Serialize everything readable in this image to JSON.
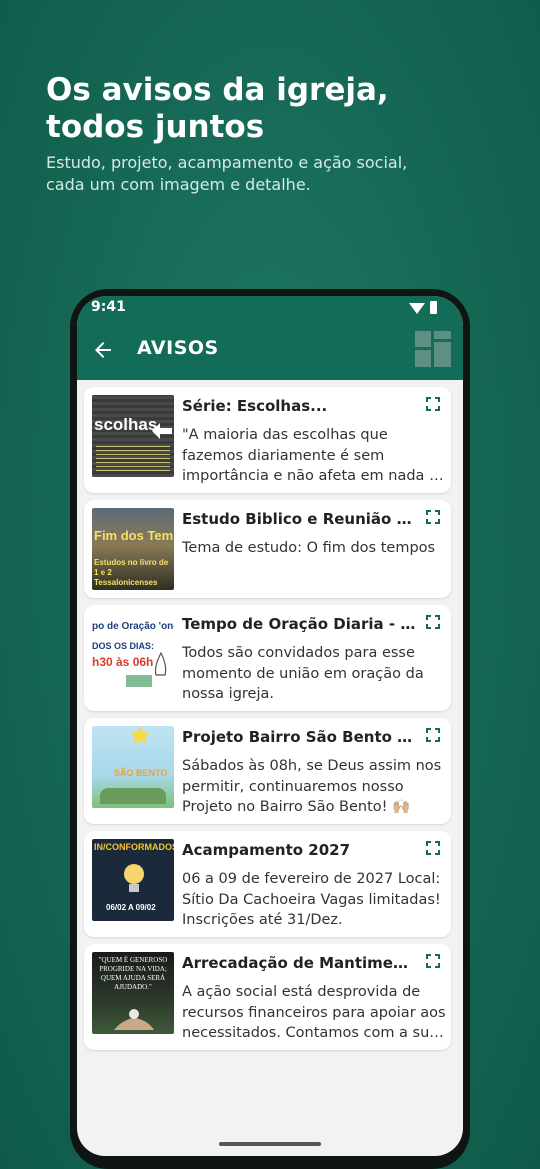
{
  "promo": {
    "headline_line1": "Os avisos da igreja,",
    "headline_line2": "todos juntos",
    "subline_line1": "Estudo, projeto, acampamento e ação social,",
    "subline_line2": "cada um com imagem e detalhe."
  },
  "status_bar": {
    "time": "9:41"
  },
  "app_bar": {
    "title": "AVISOS",
    "back_icon": "arrow-left-icon",
    "layout_icon": "grid-layout-icon"
  },
  "avisos": [
    {
      "title": "Série: Escolhas...",
      "description": "\"A maioria das escolhas que fazemos diariamente é sem importância e não afeta em nada a vida...",
      "thumb_text": "scolhas"
    },
    {
      "title": "Estudo Biblico e Reunião de Oração",
      "description": "Tema de estudo: O fim dos tempos",
      "thumb_text": "Fim dos Tempo",
      "thumb_subtext": "Estudos no livro de 1 e 2 Tessalonicenses"
    },
    {
      "title": "Tempo de Oração Diaria - Todos os dias",
      "description": "Todos são convidados para esse momento de união em oração da nossa igreja.",
      "thumb_text": "po de Oração 'on-l",
      "thumb_subtext": "DOS OS DIAS:",
      "thumb_time": "h30 às 06h"
    },
    {
      "title": "Projeto Bairro São Bento para todos",
      "description": "Sábados às 08h, se Deus assim nos permitir, continuaremos nosso Projeto no Bairro São Bento! 🙌🏼",
      "thumb_text": "SÃO BENTO"
    },
    {
      "title": "Acampamento 2027",
      "description": "06 a 09 de fevereiro de 2027 Local: Sítio Da Cachoeira Vagas limitadas! Inscrições até 31/Dez.",
      "thumb_text": "IN/CONFORMADOS",
      "thumb_subtext": "06/02 A 09/02"
    },
    {
      "title": "Arrecadação de Mantimentos",
      "description": "A ação social está desprovida de recursos financeiros para apoiar aos necessitados. Contamos com a sua ajuda.",
      "thumb_text": "\"QUEM É GENEROSO PROGRIDE NA VIDA; QUEM AJUDA SERÁ AJUDADO.\""
    }
  ],
  "colors": {
    "primary": "#136c57",
    "background": "#f2f2f2",
    "accent": "#1f7a66"
  }
}
